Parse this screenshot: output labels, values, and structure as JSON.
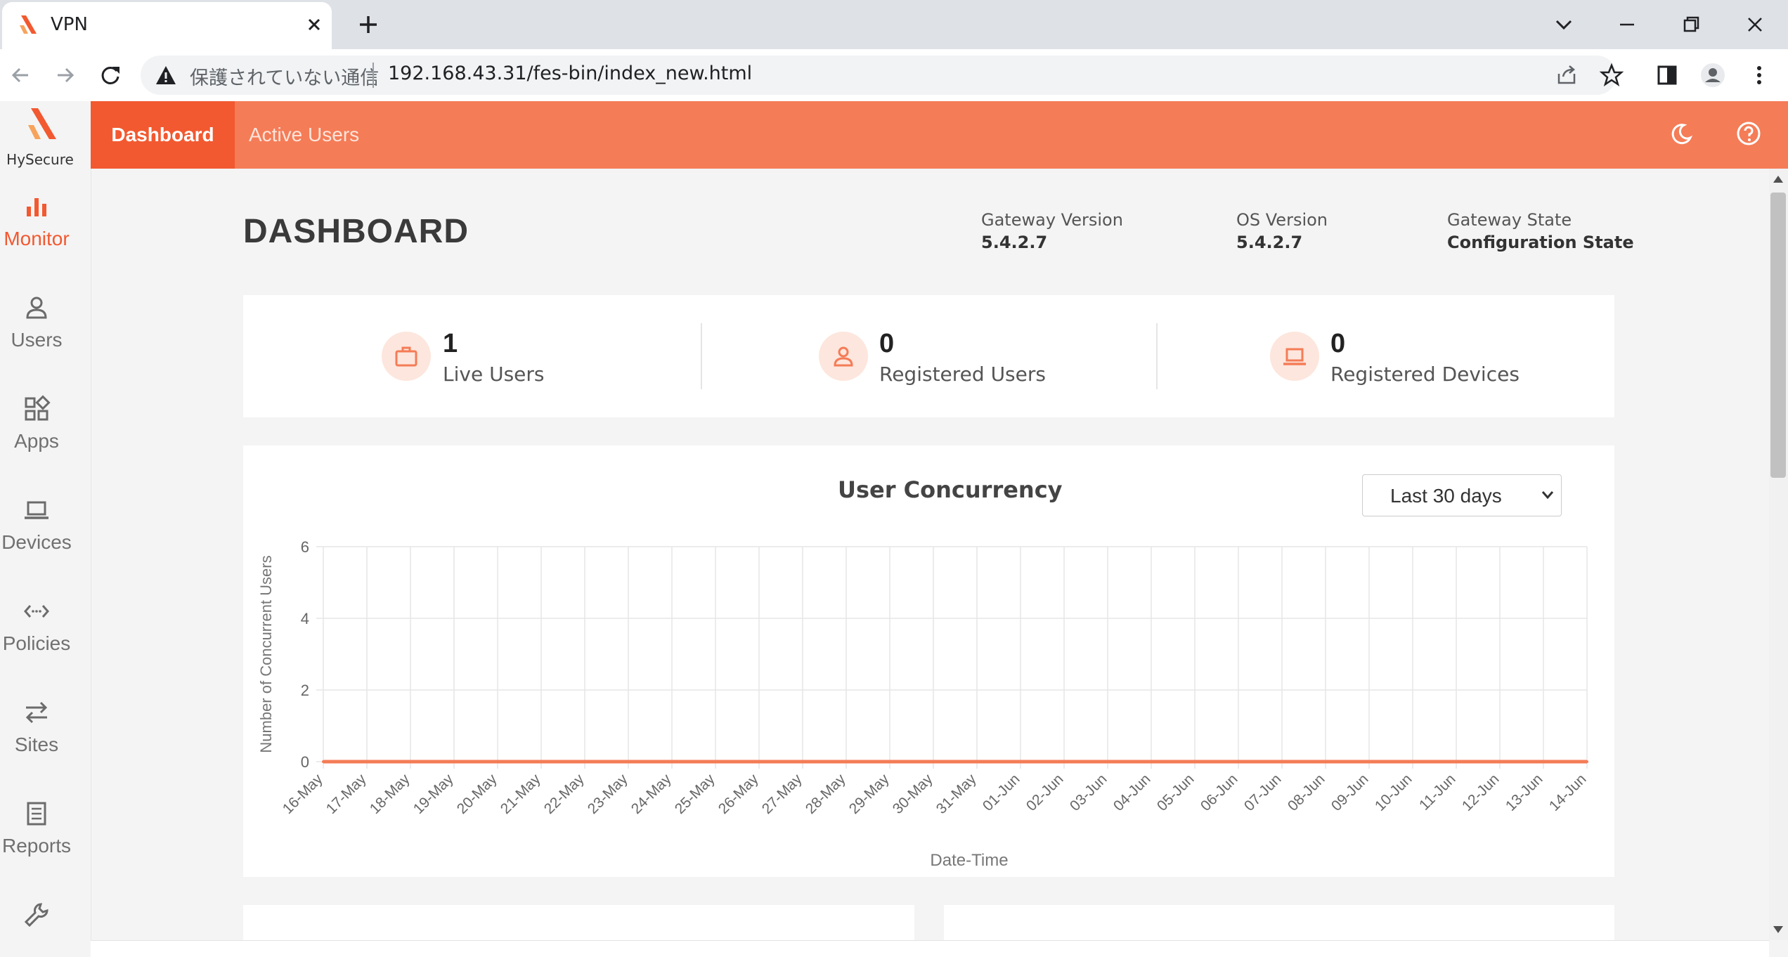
{
  "browser": {
    "tab_title": "VPN",
    "address_security_label": "保護されていない通信",
    "address_url": "192.168.43.31/fes-bin/index_new.html"
  },
  "app": {
    "logo_text": "HySecure",
    "brand_color": "#f47c57",
    "active_color": "#f25930",
    "nav_tabs": [
      {
        "label": "Dashboard",
        "active": true
      },
      {
        "label": "Active Users",
        "active": false
      }
    ],
    "header_icons": [
      "moon-icon",
      "help-icon"
    ]
  },
  "sidebar": {
    "items": [
      {
        "label": "Monitor",
        "icon": "bar-chart-icon",
        "active": true
      },
      {
        "label": "Users",
        "icon": "user-icon",
        "active": false
      },
      {
        "label": "Apps",
        "icon": "apps-grid-icon",
        "active": false
      },
      {
        "label": "Devices",
        "icon": "laptop-icon",
        "active": false
      },
      {
        "label": "Policies",
        "icon": "policies-arrows-icon",
        "active": false
      },
      {
        "label": "Sites",
        "icon": "swap-arrows-icon",
        "active": false
      },
      {
        "label": "Reports",
        "icon": "report-icon",
        "active": false
      },
      {
        "label": "",
        "icon": "wrench-icon",
        "active": false
      }
    ]
  },
  "dashboard": {
    "title": "DASHBOARD",
    "gateway_version_label": "Gateway Version",
    "gateway_version": "5.4.2.7",
    "os_version_label": "OS Version",
    "os_version": "5.4.2.7",
    "gateway_state_label": "Gateway State",
    "gateway_state": "Configuration State",
    "stats": [
      {
        "value": "1",
        "label": "Live Users",
        "icon": "briefcase-icon"
      },
      {
        "value": "0",
        "label": "Registered Users",
        "icon": "user-icon"
      },
      {
        "value": "0",
        "label": "Registered Devices",
        "icon": "laptop-icon"
      }
    ],
    "range_select": "Last 30 days"
  },
  "chart_data": {
    "type": "line",
    "title": "User Concurrency",
    "xlabel": "Date-Time",
    "ylabel": "Number of Concurrent Users",
    "ylim": [
      0,
      6
    ],
    "yticks": [
      0,
      2,
      4,
      6
    ],
    "grid": true,
    "categories": [
      "16-May",
      "17-May",
      "18-May",
      "19-May",
      "20-May",
      "21-May",
      "22-May",
      "23-May",
      "24-May",
      "25-May",
      "26-May",
      "27-May",
      "28-May",
      "29-May",
      "30-May",
      "31-May",
      "01-Jun",
      "02-Jun",
      "03-Jun",
      "04-Jun",
      "05-Jun",
      "06-Jun",
      "07-Jun",
      "08-Jun",
      "09-Jun",
      "10-Jun",
      "11-Jun",
      "12-Jun",
      "13-Jun",
      "14-Jun"
    ],
    "series": [
      {
        "values": [
          0,
          0,
          0,
          0,
          0,
          0,
          0,
          0,
          0,
          0,
          0,
          0,
          0,
          0,
          0,
          0,
          0,
          0,
          0,
          0,
          0,
          0,
          0,
          0,
          0,
          0,
          0,
          0,
          0,
          0
        ],
        "color": "#f47c57"
      }
    ]
  }
}
